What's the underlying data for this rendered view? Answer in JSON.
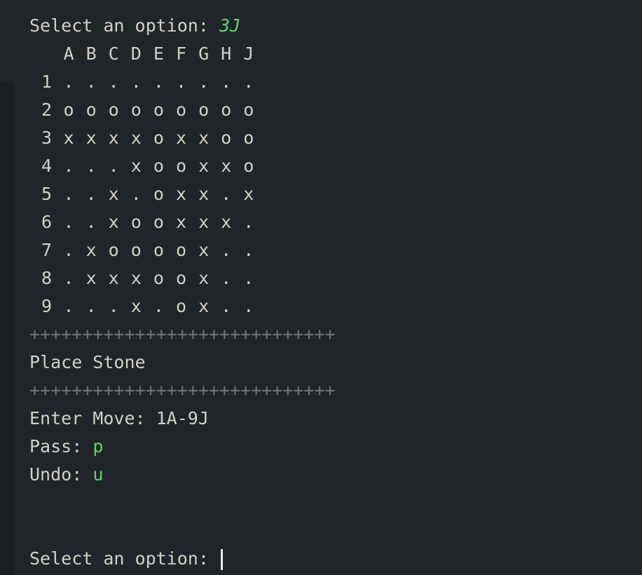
{
  "prompt_line": {
    "label": "Select an option: ",
    "input": "3J"
  },
  "board": {
    "columns": [
      "A",
      "B",
      "C",
      "D",
      "E",
      "F",
      "G",
      "H",
      "J"
    ],
    "rows": [
      {
        "label": "1",
        "cells": [
          ".",
          ".",
          ".",
          ".",
          ".",
          ".",
          ".",
          ".",
          "."
        ]
      },
      {
        "label": "2",
        "cells": [
          "o",
          "o",
          "o",
          "o",
          "o",
          "o",
          "o",
          "o",
          "o"
        ]
      },
      {
        "label": "3",
        "cells": [
          "x",
          "x",
          "x",
          "x",
          "o",
          "x",
          "x",
          "o",
          "o"
        ]
      },
      {
        "label": "4",
        "cells": [
          ".",
          ".",
          ".",
          "x",
          "o",
          "o",
          "x",
          "x",
          "o"
        ]
      },
      {
        "label": "5",
        "cells": [
          ".",
          ".",
          "x",
          ".",
          "o",
          "x",
          "x",
          ".",
          "x"
        ]
      },
      {
        "label": "6",
        "cells": [
          ".",
          ".",
          "x",
          "o",
          "o",
          "x",
          "x",
          "x",
          "."
        ]
      },
      {
        "label": "7",
        "cells": [
          ".",
          "x",
          "o",
          "o",
          "o",
          "o",
          "x",
          ".",
          "."
        ]
      },
      {
        "label": "8",
        "cells": [
          ".",
          "x",
          "x",
          "x",
          "o",
          "o",
          "x",
          ".",
          "."
        ]
      },
      {
        "label": "9",
        "cells": [
          ".",
          ".",
          ".",
          "x",
          ".",
          "o",
          "x",
          ".",
          "."
        ]
      }
    ]
  },
  "menu": {
    "separator": "+++++++++++++++++++++++++++++",
    "title": "Place Stone",
    "enter_move_label": "Enter Move: ",
    "enter_move_value": "1A-9J",
    "pass_label": "Pass: ",
    "pass_key": "p",
    "undo_label": "Undo: ",
    "undo_key": "u"
  },
  "final_prompt": {
    "label": "Select an option: "
  },
  "colors": {
    "background": "#1f2528",
    "text": "#d4d0c6",
    "accent_green": "#5fd46a",
    "separator": "#6c7376"
  }
}
